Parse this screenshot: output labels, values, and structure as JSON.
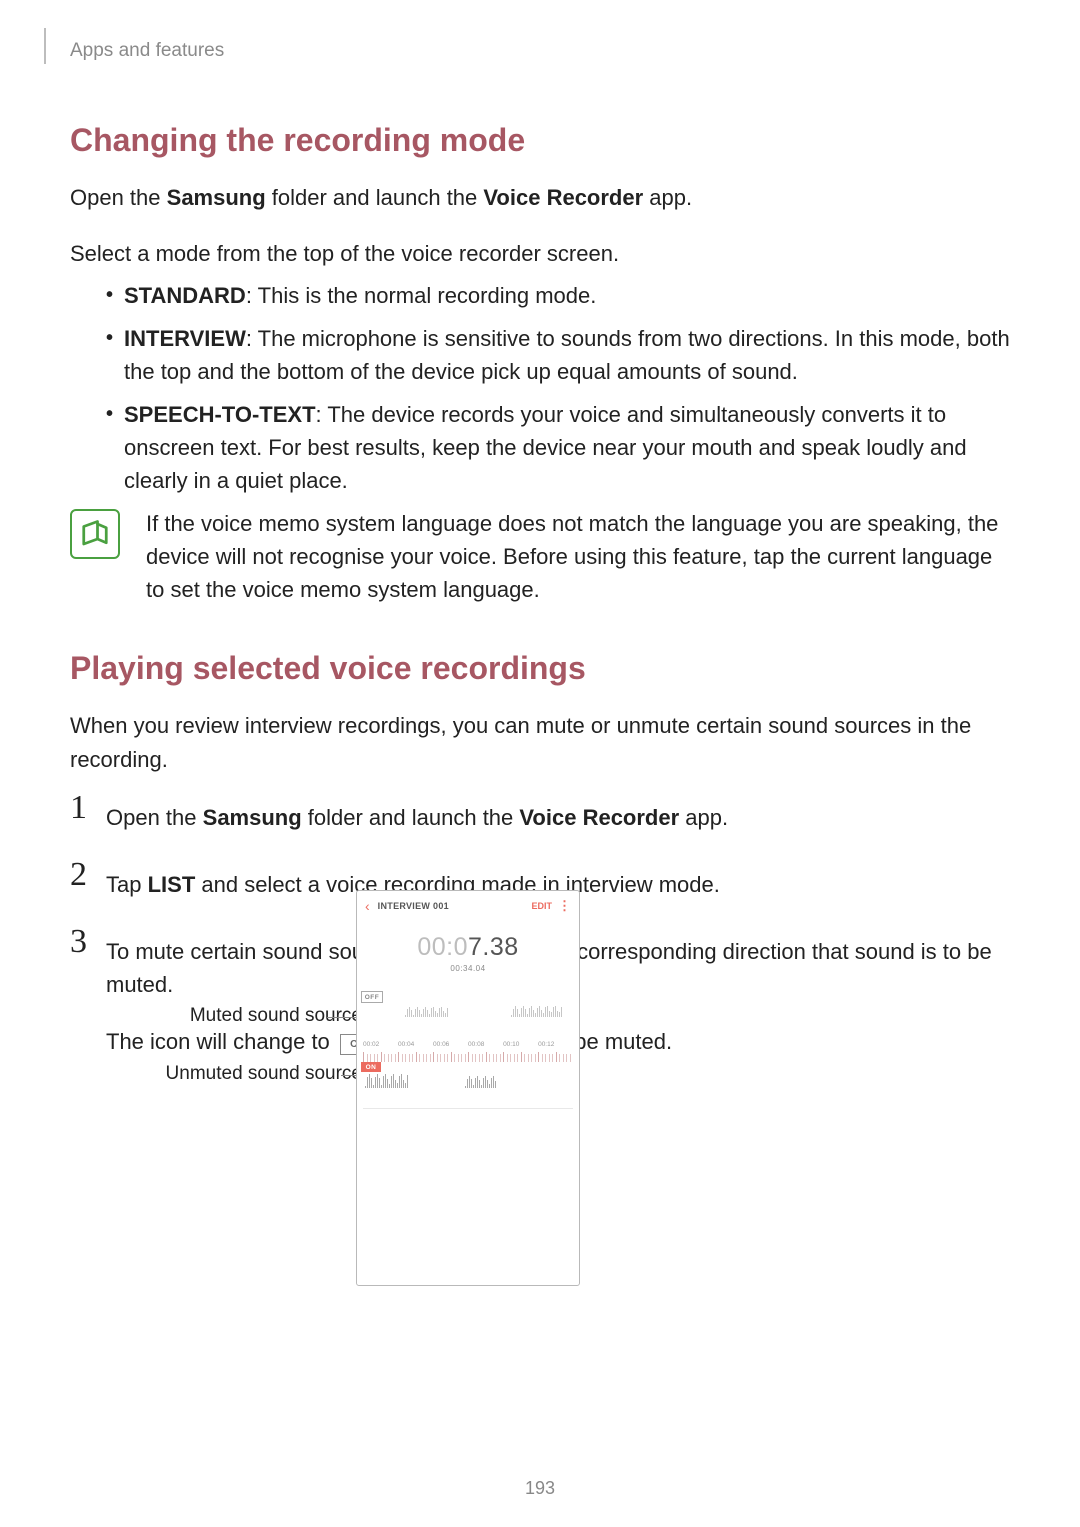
{
  "breadcrumb": "Apps and features",
  "section1": {
    "title": "Changing the recording mode",
    "p1_a": "Open the ",
    "p1_b_bold": "Samsung",
    "p1_c": " folder and launch the ",
    "p1_d_bold": "Voice Recorder",
    "p1_e": " app.",
    "p2": "Select a mode from the top of the voice recorder screen.",
    "modes": [
      {
        "name": "STANDARD",
        "desc": ": This is the normal recording mode."
      },
      {
        "name": "INTERVIEW",
        "desc": ": The microphone is sensitive to sounds from two directions. In this mode, both the top and the bottom of the device pick up equal amounts of sound."
      },
      {
        "name": "SPEECH-TO-TEXT",
        "desc": ": The device records your voice and simultaneously converts it to onscreen text. For best results, keep the device near your mouth and speak loudly and clearly in a quiet place."
      }
    ],
    "note": "If the voice memo system language does not match the language you are speaking, the device will not recognise your voice. Before using this feature, tap the current language to set the voice memo system language."
  },
  "section2": {
    "title": "Playing selected voice recordings",
    "intro": "When you review interview recordings, you can mute or unmute certain sound sources in the recording.",
    "step1_a": "Open the ",
    "step1_b_bold": "Samsung",
    "step1_c": " folder and launch the ",
    "step1_d_bold": "Voice Recorder",
    "step1_e": " app.",
    "step2_a": "Tap ",
    "step2_b_bold": "LIST",
    "step2_c": " and select a voice recording made in interview mode.",
    "step3_a": "To mute certain sound sources, tap ",
    "step3_on": "ON",
    "step3_b": " for the corresponding direction that sound is to be muted.",
    "step3_sub_a": "The icon will change to ",
    "step3_off": "OFF",
    "step3_sub_b": " and the sound will be muted."
  },
  "callouts": {
    "muted": "Muted sound source",
    "unmuted": "Unmuted sound source"
  },
  "phone": {
    "title": "INTERVIEW 001",
    "edit": "EDIT",
    "time_gray": "00:0",
    "time_rest": "7.38",
    "total": "00:34.04",
    "ticks": [
      "00:02",
      "00:04",
      "00:06",
      "00:08",
      "00:10",
      "00:12"
    ],
    "off": "OFF",
    "on": "ON"
  },
  "page_number": "193"
}
